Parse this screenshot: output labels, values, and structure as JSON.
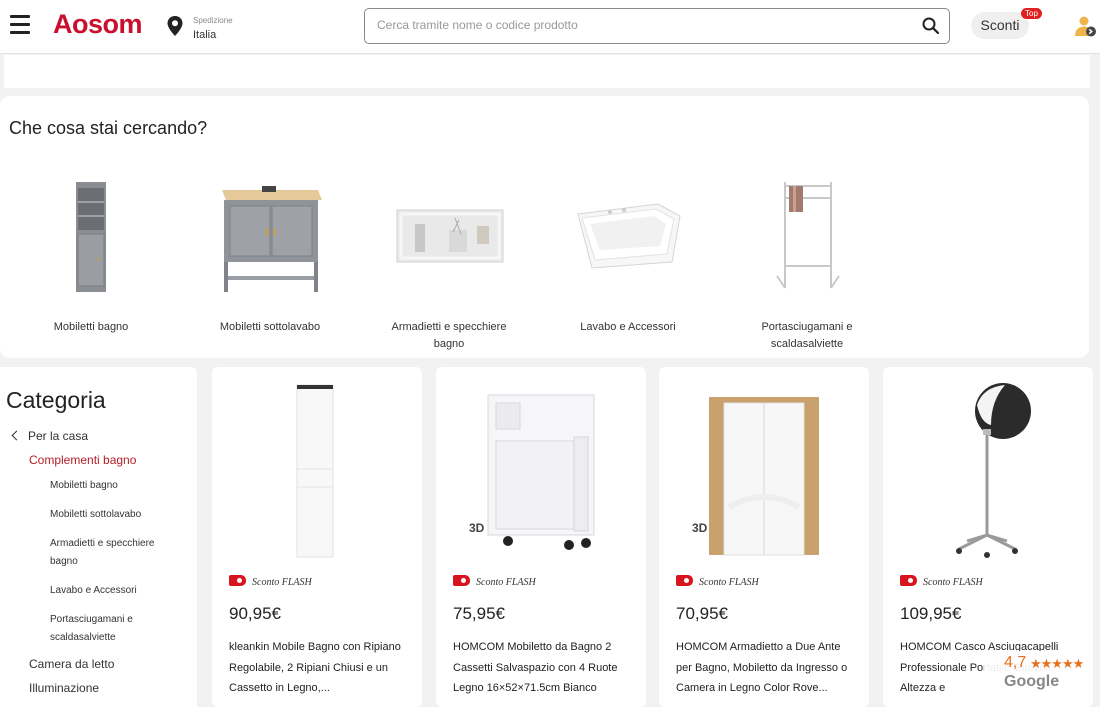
{
  "header": {
    "logo_text": "Aosom",
    "ship_label": "Spedizione",
    "ship_value": "Italia",
    "search_placeholder": "Cerca tramite nome o codice prodotto",
    "sconti_label": "Sconti",
    "top_badge": "Top"
  },
  "categories_section": {
    "title": "Che cosa stai cercando?",
    "items": [
      {
        "label": "Mobiletti bagno"
      },
      {
        "label": "Mobiletti sottolavabo"
      },
      {
        "label": "Armadietti e specchiere bagno"
      },
      {
        "label": "Lavabo e Accessori"
      },
      {
        "label": "Portasciugamani e scaldasalviette"
      }
    ]
  },
  "sidebar": {
    "title": "Categoria",
    "back_label": "Per la casa",
    "active_label": "Complementi bagno",
    "sub_items": [
      "Mobiletti bagno",
      "Mobiletti sottolavabo",
      "Armadietti e specchiere bagno",
      "Lavabo e Accessori",
      "Portasciugamani e scaldasalviette"
    ],
    "main_items": [
      "Camera da letto",
      "Illuminazione"
    ]
  },
  "products": [
    {
      "flash": "Sconto FLASH",
      "price": "90,95€",
      "desc": "kleankin Mobile Bagno con Ripiano Regolabile, 2 Ripiani Chiusi e un Cassetto in Legno,...",
      "badge": ""
    },
    {
      "flash": "Sconto FLASH",
      "price": "75,95€",
      "desc": "HOMCOM Mobiletto da Bagno 2 Cassetti Salvaspazio con 4 Ruote Legno 16×52×71.5cm Bianco",
      "badge": "3D"
    },
    {
      "flash": "Sconto FLASH",
      "price": "70,95€",
      "desc": "HOMCOM Armadietto a Due Ante per Bagno, Mobiletto da Ingresso o Camera in Legno Color Rove...",
      "badge": "3D"
    },
    {
      "flash": "Sconto FLASH",
      "price": "109,95€",
      "desc": "HOMCOM Casco Asciugacapelli Professionale Portatile Girevoli, Altezza e",
      "badge": ""
    }
  ],
  "google_rating": {
    "score": "4,7",
    "stars": "★★★★★",
    "brand": "Google"
  },
  "colors": {
    "brand_red": "#c8102e",
    "active_red": "#b51e24",
    "flash_red": "#d8141e",
    "rating_orange": "#e7711b"
  }
}
